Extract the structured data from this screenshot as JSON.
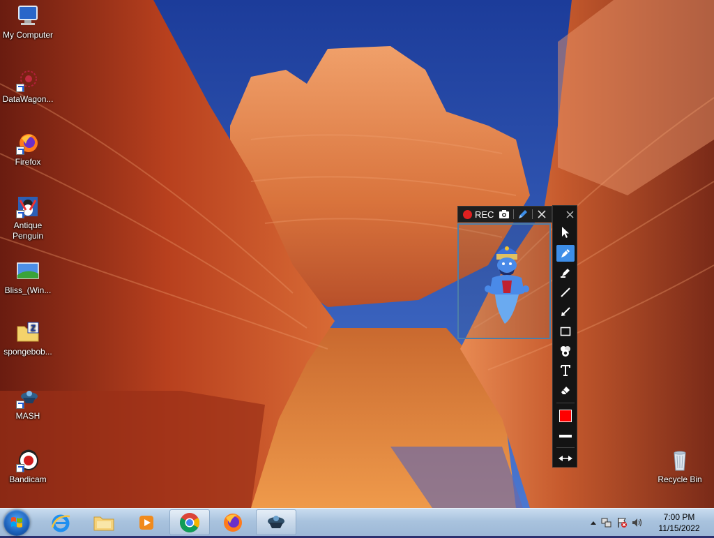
{
  "desktop": {
    "icons": [
      {
        "label": "My Computer",
        "icon": "computer-icon"
      },
      {
        "label": "DataWagon...",
        "icon": "datawagon-icon"
      },
      {
        "label": "Firefox",
        "icon": "firefox-icon"
      },
      {
        "label": "Antique Penguin",
        "icon": "penguin-icon"
      },
      {
        "label": "Bliss_(Win...",
        "icon": "image-file-icon"
      },
      {
        "label": "spongebob...",
        "icon": "zip-folder-icon"
      },
      {
        "label": "MASH",
        "icon": "mash-icon"
      },
      {
        "label": "Bandicam",
        "icon": "bandicam-icon"
      },
      {
        "label": "Recycle Bin",
        "icon": "recycle-bin-icon"
      }
    ]
  },
  "recorder": {
    "rec_label": "REC",
    "rec_color": "#e02020",
    "active_tool_color": "#3d8ee8",
    "selected_color": "#ff0000",
    "tools": [
      "cursor-tool-icon",
      "pen-tool-icon",
      "highlighter-tool-icon",
      "line-tool-icon",
      "arrow-tool-icon",
      "rectangle-tool-icon",
      "numbering-tool-icon",
      "text-tool-icon",
      "eraser-tool-icon",
      "color-swatch-icon",
      "line-width-icon",
      "collapse-toggle-icon"
    ]
  },
  "taskbar": {
    "apps": [
      "internet-explorer-icon",
      "file-explorer-icon",
      "media-player-icon",
      "chrome-icon",
      "firefox-icon",
      "mash-icon"
    ],
    "time": "7:00 PM",
    "date": "11/15/2022"
  }
}
